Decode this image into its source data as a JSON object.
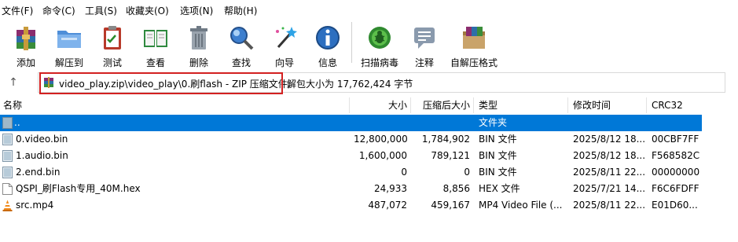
{
  "menu": [
    "文件(F)",
    "命令(C)",
    "工具(S)",
    "收藏夹(O)",
    "选项(N)",
    "帮助(H)"
  ],
  "toolbar": [
    {
      "label": "添加",
      "icon": "archive-add-icon"
    },
    {
      "label": "解压到",
      "icon": "folder-extract-icon"
    },
    {
      "label": "测试",
      "icon": "clipboard-test-icon"
    },
    {
      "label": "查看",
      "icon": "book-view-icon"
    },
    {
      "label": "删除",
      "icon": "trash-delete-icon"
    },
    {
      "label": "查找",
      "icon": "magnifier-find-icon"
    },
    {
      "label": "向导",
      "icon": "magic-wand-icon"
    },
    {
      "label": "信息",
      "icon": "info-icon"
    },
    {
      "label": "扫描病毒",
      "icon": "virus-scan-icon"
    },
    {
      "label": "注释",
      "icon": "comment-icon"
    },
    {
      "label": "自解压格式",
      "icon": "sfx-archive-icon"
    }
  ],
  "address": {
    "path": "video_play.zip\\video_play\\0.刷flash - ZIP 压缩文件,",
    "info": "解包大小为 17,762,424 字节"
  },
  "columns": {
    "name": "名称",
    "size": "大小",
    "packed": "压缩后大小",
    "type": "类型",
    "modified": "修改时间",
    "crc": "CRC32"
  },
  "files": [
    {
      "name": "..",
      "size": "",
      "packed": "",
      "type": "文件夹",
      "modified": "",
      "crc": "",
      "icon": "folder-up-icon",
      "selected": true
    },
    {
      "name": "0.video.bin",
      "size": "12,800,000",
      "packed": "1,784,902",
      "type": "BIN 文件",
      "modified": "2025/8/12 18...",
      "crc": "00CBF7FF",
      "icon": "bin-file-icon",
      "selected": false
    },
    {
      "name": "1.audio.bin",
      "size": "1,600,000",
      "packed": "789,121",
      "type": "BIN 文件",
      "modified": "2025/8/12 18...",
      "crc": "F568582C",
      "icon": "bin-file-icon",
      "selected": false
    },
    {
      "name": "2.end.bin",
      "size": "0",
      "packed": "0",
      "type": "BIN 文件",
      "modified": "2025/8/11 22...",
      "crc": "00000000",
      "icon": "bin-file-icon",
      "selected": false
    },
    {
      "name": "QSPI_刷Flash专用_40M.hex",
      "size": "24,933",
      "packed": "8,856",
      "type": "HEX 文件",
      "modified": "2025/7/21 14...",
      "crc": "F6C6FDFF",
      "icon": "hex-file-icon",
      "selected": false
    },
    {
      "name": "src.mp4",
      "size": "487,072",
      "packed": "459,167",
      "type": "MP4 Video File (...",
      "modified": "2025/8/11 22...",
      "crc": "E01D60...",
      "icon": "vlc-file-icon",
      "selected": false
    }
  ],
  "colors": {
    "selection": "#0078d7",
    "highlight_border": "#d32020"
  }
}
